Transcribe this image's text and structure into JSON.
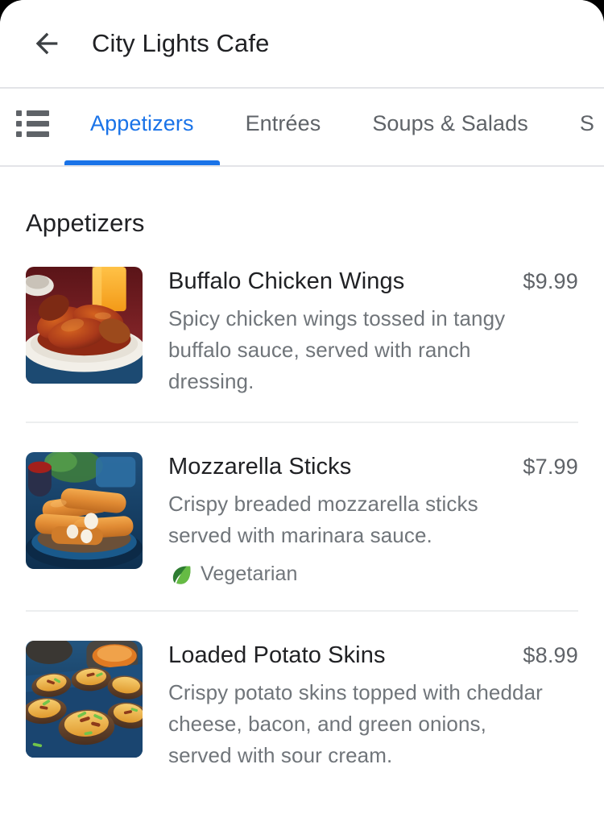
{
  "header": {
    "back_icon": "arrow-left-icon",
    "title": "City Lights Cafe"
  },
  "tabs": {
    "list_icon": "list-icon",
    "items": [
      {
        "label": "Appetizers",
        "active": true
      },
      {
        "label": "Entrées",
        "active": false
      },
      {
        "label": "Soups & Salads",
        "active": false
      },
      {
        "label": "S",
        "active": false
      }
    ],
    "active_color": "#1a73e8",
    "inactive_color": "#5f6368"
  },
  "section": {
    "title": "Appetizers"
  },
  "menu_items": [
    {
      "name": "Buffalo Chicken Wings",
      "price": "$9.99",
      "description": "Spicy chicken wings tossed in tangy buffalo sauce, served with ranch dressing.",
      "image": "buffalo-chicken-wings-photo",
      "tag": null
    },
    {
      "name": "Mozzarella Sticks",
      "price": "$7.99",
      "description": "Crispy breaded mozzarella sticks served with marinara sauce.",
      "image": "mozzarella-sticks-photo",
      "tag": {
        "icon": "leaf-icon",
        "label": "Vegetarian",
        "color": "#4caf50"
      }
    },
    {
      "name": "Loaded Potato Skins",
      "price": "$8.99",
      "description": "Crispy potato skins topped with cheddar cheese, bacon, and green onions, served with sour cream.",
      "image": "loaded-potato-skins-photo",
      "tag": null
    }
  ]
}
